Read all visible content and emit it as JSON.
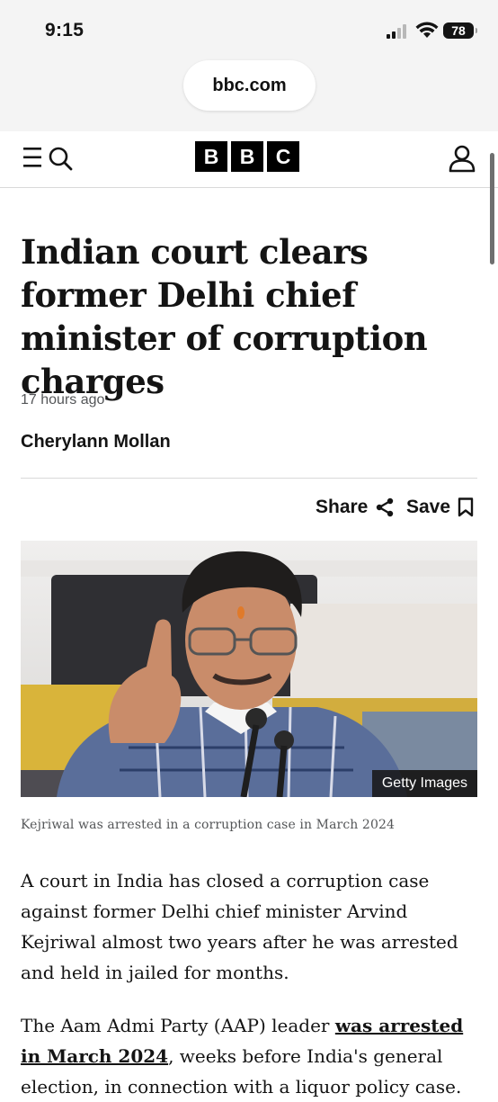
{
  "status_bar": {
    "time": "9:15",
    "battery": "78",
    "icons": [
      "signal-icon",
      "wifi-icon",
      "battery-icon"
    ]
  },
  "browser": {
    "url": "bbc.com"
  },
  "site_header": {
    "menu_icon": "menu-icon",
    "search_icon": "search-icon",
    "logo_letters": [
      "B",
      "B",
      "C"
    ],
    "account_icon": "user-account-icon"
  },
  "article": {
    "headline": "Indian court clears former Delhi chief minister of corruption charges",
    "timestamp": "17 hours ago",
    "author": "Cherylann Mollan",
    "actions": {
      "share_label": "Share",
      "save_label": "Save"
    },
    "image": {
      "credit": "Getty Images",
      "caption": "Kejriwal was arrested in a corruption case in March 2024"
    },
    "paragraph1": "A court in India has closed a corruption case against former Delhi chief minister Arvind Kejriwal almost two years after he was arrested and held in jailed for months.",
    "paragraph2": {
      "before_link": "The Aam Admi Party (AAP) leader ",
      "link_text": "was arrested in March 2024",
      "after_link": ", weeks before India's general election, in connection with a liquor policy case."
    }
  },
  "colors": {
    "brand_black": "#000000",
    "text": "#141414",
    "meta_grey": "#545658",
    "browser_chrome": "#f4f4f4"
  }
}
